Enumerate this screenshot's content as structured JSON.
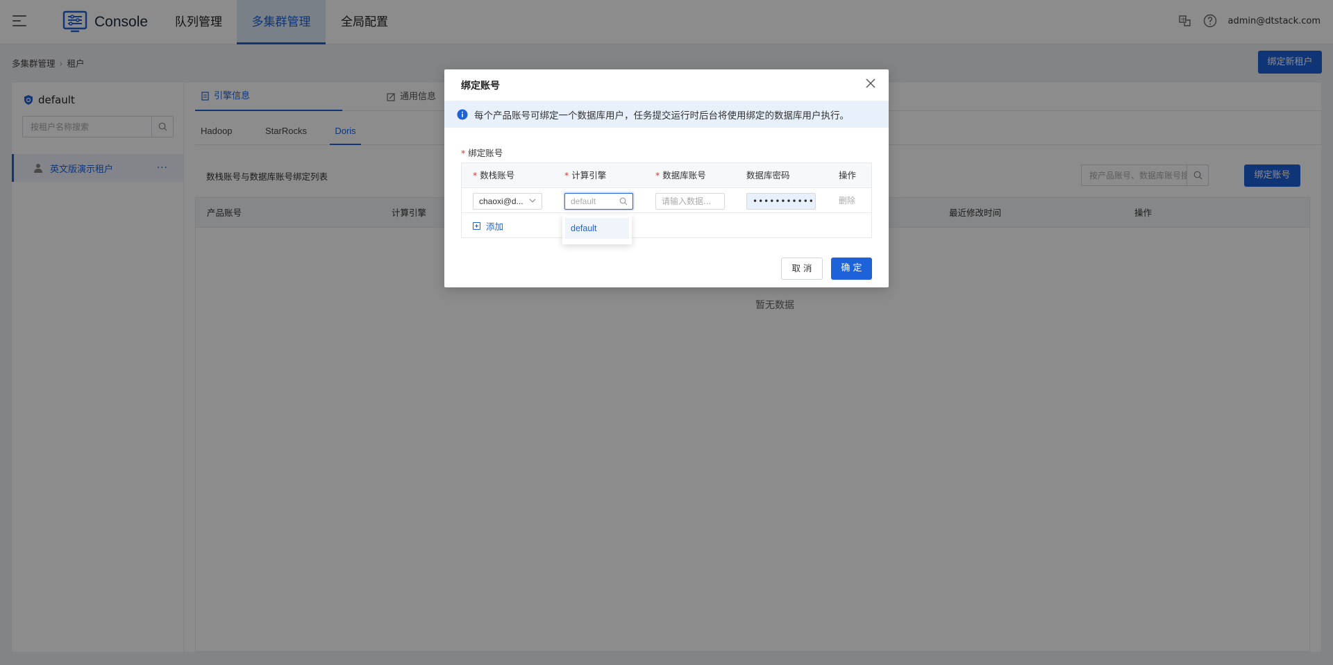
{
  "app": {
    "brand": "Console",
    "nav": [
      {
        "label": "队列管理"
      },
      {
        "label": "多集群管理",
        "active": true
      },
      {
        "label": "全局配置"
      }
    ],
    "user": "admin@dtstack.com",
    "icons": {
      "menu": "menu-icon",
      "language": "language-icon",
      "help": "help-icon"
    }
  },
  "breadcrumb": {
    "parent": "多集群管理",
    "current": "租户"
  },
  "header_action": {
    "bind_tenant_label": "绑定新租户"
  },
  "sidebar": {
    "cluster_name": "default",
    "search_placeholder": "按租户名称搜索",
    "tenants": [
      {
        "name": "英文版演示租户",
        "more": "···"
      }
    ]
  },
  "main": {
    "info_tabs": [
      {
        "label": "引擎信息",
        "active": true
      },
      {
        "label": "通用信息"
      }
    ],
    "engine_tabs": [
      {
        "label": "Hadoop"
      },
      {
        "label": "StarRocks"
      },
      {
        "label": "Doris",
        "active": true
      }
    ],
    "list_title": "数栈账号与数据库账号绑定列表",
    "search_placeholder": "按产品账号、数据库账号搜索",
    "bind_account_label": "绑定账号",
    "table_columns": [
      "产品账号",
      "计算引擎",
      "最近修改时间",
      "操作"
    ],
    "empty_text": "暂无数据"
  },
  "modal": {
    "title": "绑定账号",
    "alert": "每个产品账号可绑定一个数据库用户，任务提交运行时后台将使用绑定的数据库用户执行。",
    "field_label": "绑定账号",
    "required_mark": "*",
    "columns": [
      {
        "label": "数栈账号",
        "required": true
      },
      {
        "label": "计算引擎",
        "required": true
      },
      {
        "label": "数据库账号",
        "required": true
      },
      {
        "label": "数据库密码",
        "required": false
      },
      {
        "label": "操作",
        "required": false
      }
    ],
    "row": {
      "stack_account": "chaoxi@d...",
      "engine_placeholder": "default",
      "db_account_placeholder": "请输入数据...",
      "db_password": "•••••••••••",
      "delete_label": "删除"
    },
    "add_label": "添加",
    "dropdown_options": [
      "default"
    ],
    "cancel_label": "取 消",
    "ok_label": "确 定"
  },
  "colors": {
    "primary": "#1e62d9",
    "required": "#e0352b",
    "overlay": "rgba(0,0,0,0.45)"
  }
}
